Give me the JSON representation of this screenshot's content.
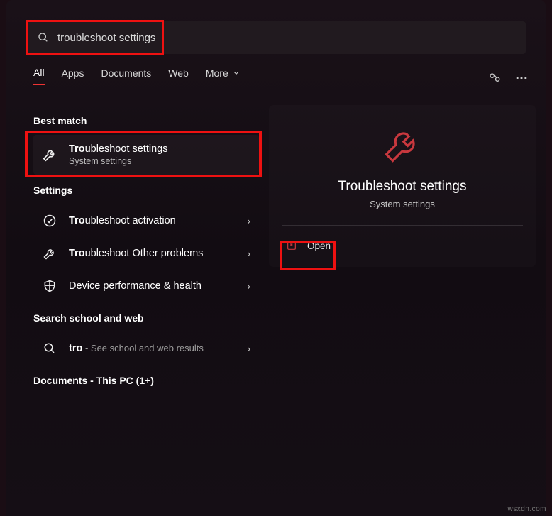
{
  "search": {
    "value": "troubleshoot settings",
    "typed_prefix": "tro"
  },
  "tabs": {
    "all": "All",
    "apps": "Apps",
    "documents": "Documents",
    "web": "Web",
    "more": "More"
  },
  "sections": {
    "best_match": "Best match",
    "settings": "Settings",
    "school_web": "Search school and web",
    "documents_header": "Documents - This PC (1+)"
  },
  "best_match": {
    "title_bold": "Tro",
    "title_rest": "ubleshoot settings",
    "subtitle": "System settings"
  },
  "settings_results": [
    {
      "title_bold": "Tro",
      "title_rest": "ubleshoot activation",
      "icon": "check-circle"
    },
    {
      "title_bold": "Tro",
      "title_rest": "ubleshoot Other problems",
      "icon": "wrench"
    },
    {
      "title_bold": "",
      "title_rest": "Device performance & health",
      "icon": "shield"
    }
  ],
  "web_result": {
    "prefix": "tro",
    "hint": " - See school and web results"
  },
  "detail": {
    "title": "Troubleshoot settings",
    "subtitle": "System settings",
    "open_label": "Open"
  },
  "watermark": "wsxdn.com",
  "colors": {
    "highlight": "#e11",
    "accent": "#c9383e"
  }
}
